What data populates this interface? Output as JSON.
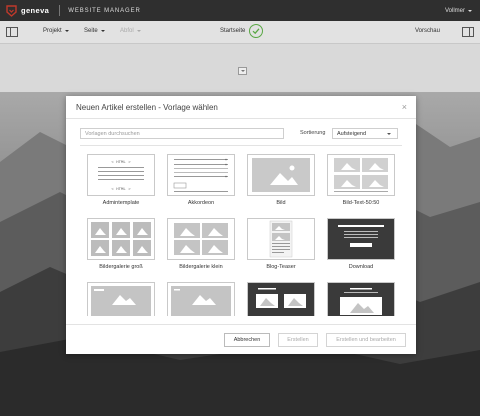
{
  "app": {
    "brand": "geneva",
    "title": "WEBSITE MANAGER",
    "user": "Vollmer"
  },
  "toolbar": {
    "menus": [
      "Projekt",
      "Seite",
      "Abfol"
    ],
    "startpage": "Startseite",
    "preview": "Vorschau"
  },
  "modal": {
    "title": "Neuen Artikel erstellen - Vorlage wählen",
    "search_placeholder": "Vorlagen durchsuchen",
    "sort_label": "Sortierung",
    "sort_value": "Aufsteigend",
    "templates": [
      {
        "label": "Admintemplate",
        "icon": "html-list-template"
      },
      {
        "label": "Akkordeon",
        "icon": "accordion-template"
      },
      {
        "label": "Bild",
        "icon": "image-template"
      },
      {
        "label": "Bild-Text-50:50",
        "icon": "image-text-grid-template"
      },
      {
        "label": "Bildergalerie groß",
        "icon": "gallery-large-template"
      },
      {
        "label": "Bildergalerie klein",
        "icon": "gallery-small-template"
      },
      {
        "label": "Blog-Teaser",
        "icon": "blog-teaser-template"
      },
      {
        "label": "Download",
        "icon": "download-template"
      },
      {
        "label": "",
        "icon": "image-with-text-template"
      },
      {
        "label": "",
        "icon": "image-with-caption-template"
      },
      {
        "label": "",
        "icon": "dark-two-images-template"
      },
      {
        "label": "",
        "icon": "dark-image-text-template"
      }
    ],
    "buttons": {
      "cancel": "Abbrechen",
      "create": "Erstellen",
      "create_edit": "Erstellen und bearbeiten"
    }
  },
  "colors": {
    "topbar": "#2f2f2f",
    "brand_red": "#c0392b",
    "check_green": "#5aa845",
    "dark_thumb": "#3a3a3a"
  }
}
